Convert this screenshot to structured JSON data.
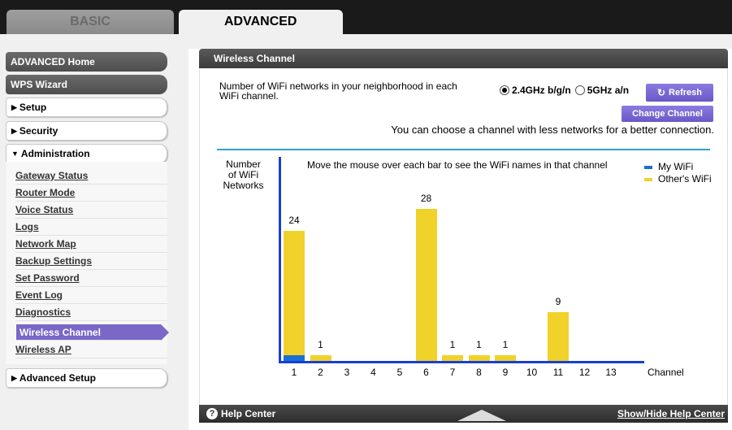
{
  "tabs": {
    "basic": "BASIC",
    "advanced": "ADVANCED"
  },
  "nav": {
    "advanced_home": "ADVANCED Home",
    "wps_wizard": "WPS Wizard",
    "setup": "Setup",
    "security": "Security",
    "administration": "Administration",
    "admin_items": [
      "Gateway Status",
      "Router Mode",
      "Voice Status",
      "Logs",
      "Network Map",
      "Backup Settings",
      "Set Password",
      "Event Log",
      "Diagnostics",
      "Wireless Channel",
      "Wireless AP"
    ],
    "advanced_setup": "Advanced Setup"
  },
  "panel": {
    "title": "Wireless Channel",
    "description": "Number of WiFi networks in your neighborhood in each WiFi channel.",
    "band_24": "2.4GHz b/g/n",
    "band_5": "5GHz a/n",
    "refresh": "Refresh",
    "change_channel": "Change Channel",
    "hint": "You can choose a channel with less networks for a better connection."
  },
  "chart_text": {
    "ylabel": "Number\nof WiFi\nNetworks",
    "instruction": "Move the mouse over each bar to see the WiFi names in that channel",
    "xlabel": "Channel",
    "legend_my": "My WiFi",
    "legend_other": "Other's WiFi"
  },
  "colors": {
    "other_wifi": "#f0d22b",
    "my_wifi": "#1a6fd6",
    "accent": "#7b67c8",
    "axis": "#1a3fd0",
    "separator": "#2aa3cf"
  },
  "chart_data": {
    "type": "bar",
    "categories": [
      "1",
      "2",
      "3",
      "4",
      "5",
      "6",
      "7",
      "8",
      "9",
      "10",
      "11",
      "12",
      "13"
    ],
    "series": [
      {
        "name": "Other's WiFi",
        "values": [
          24,
          1,
          0,
          0,
          0,
          28,
          1,
          1,
          1,
          0,
          9,
          0,
          0
        ]
      },
      {
        "name": "My WiFi",
        "values": [
          1,
          0,
          0,
          0,
          0,
          0,
          0,
          0,
          0,
          0,
          0,
          0,
          0
        ]
      }
    ],
    "data_labels": [
      "24",
      "1",
      "",
      "",
      "",
      "28",
      "1",
      "1",
      "1",
      "",
      "9",
      "",
      ""
    ],
    "xlabel": "Channel",
    "ylabel": "Number of WiFi Networks",
    "ylim": [
      0,
      31
    ],
    "legend": "top-right"
  },
  "footer": {
    "help_center": "Help Center",
    "toggle": "Show/Hide Help Center"
  }
}
